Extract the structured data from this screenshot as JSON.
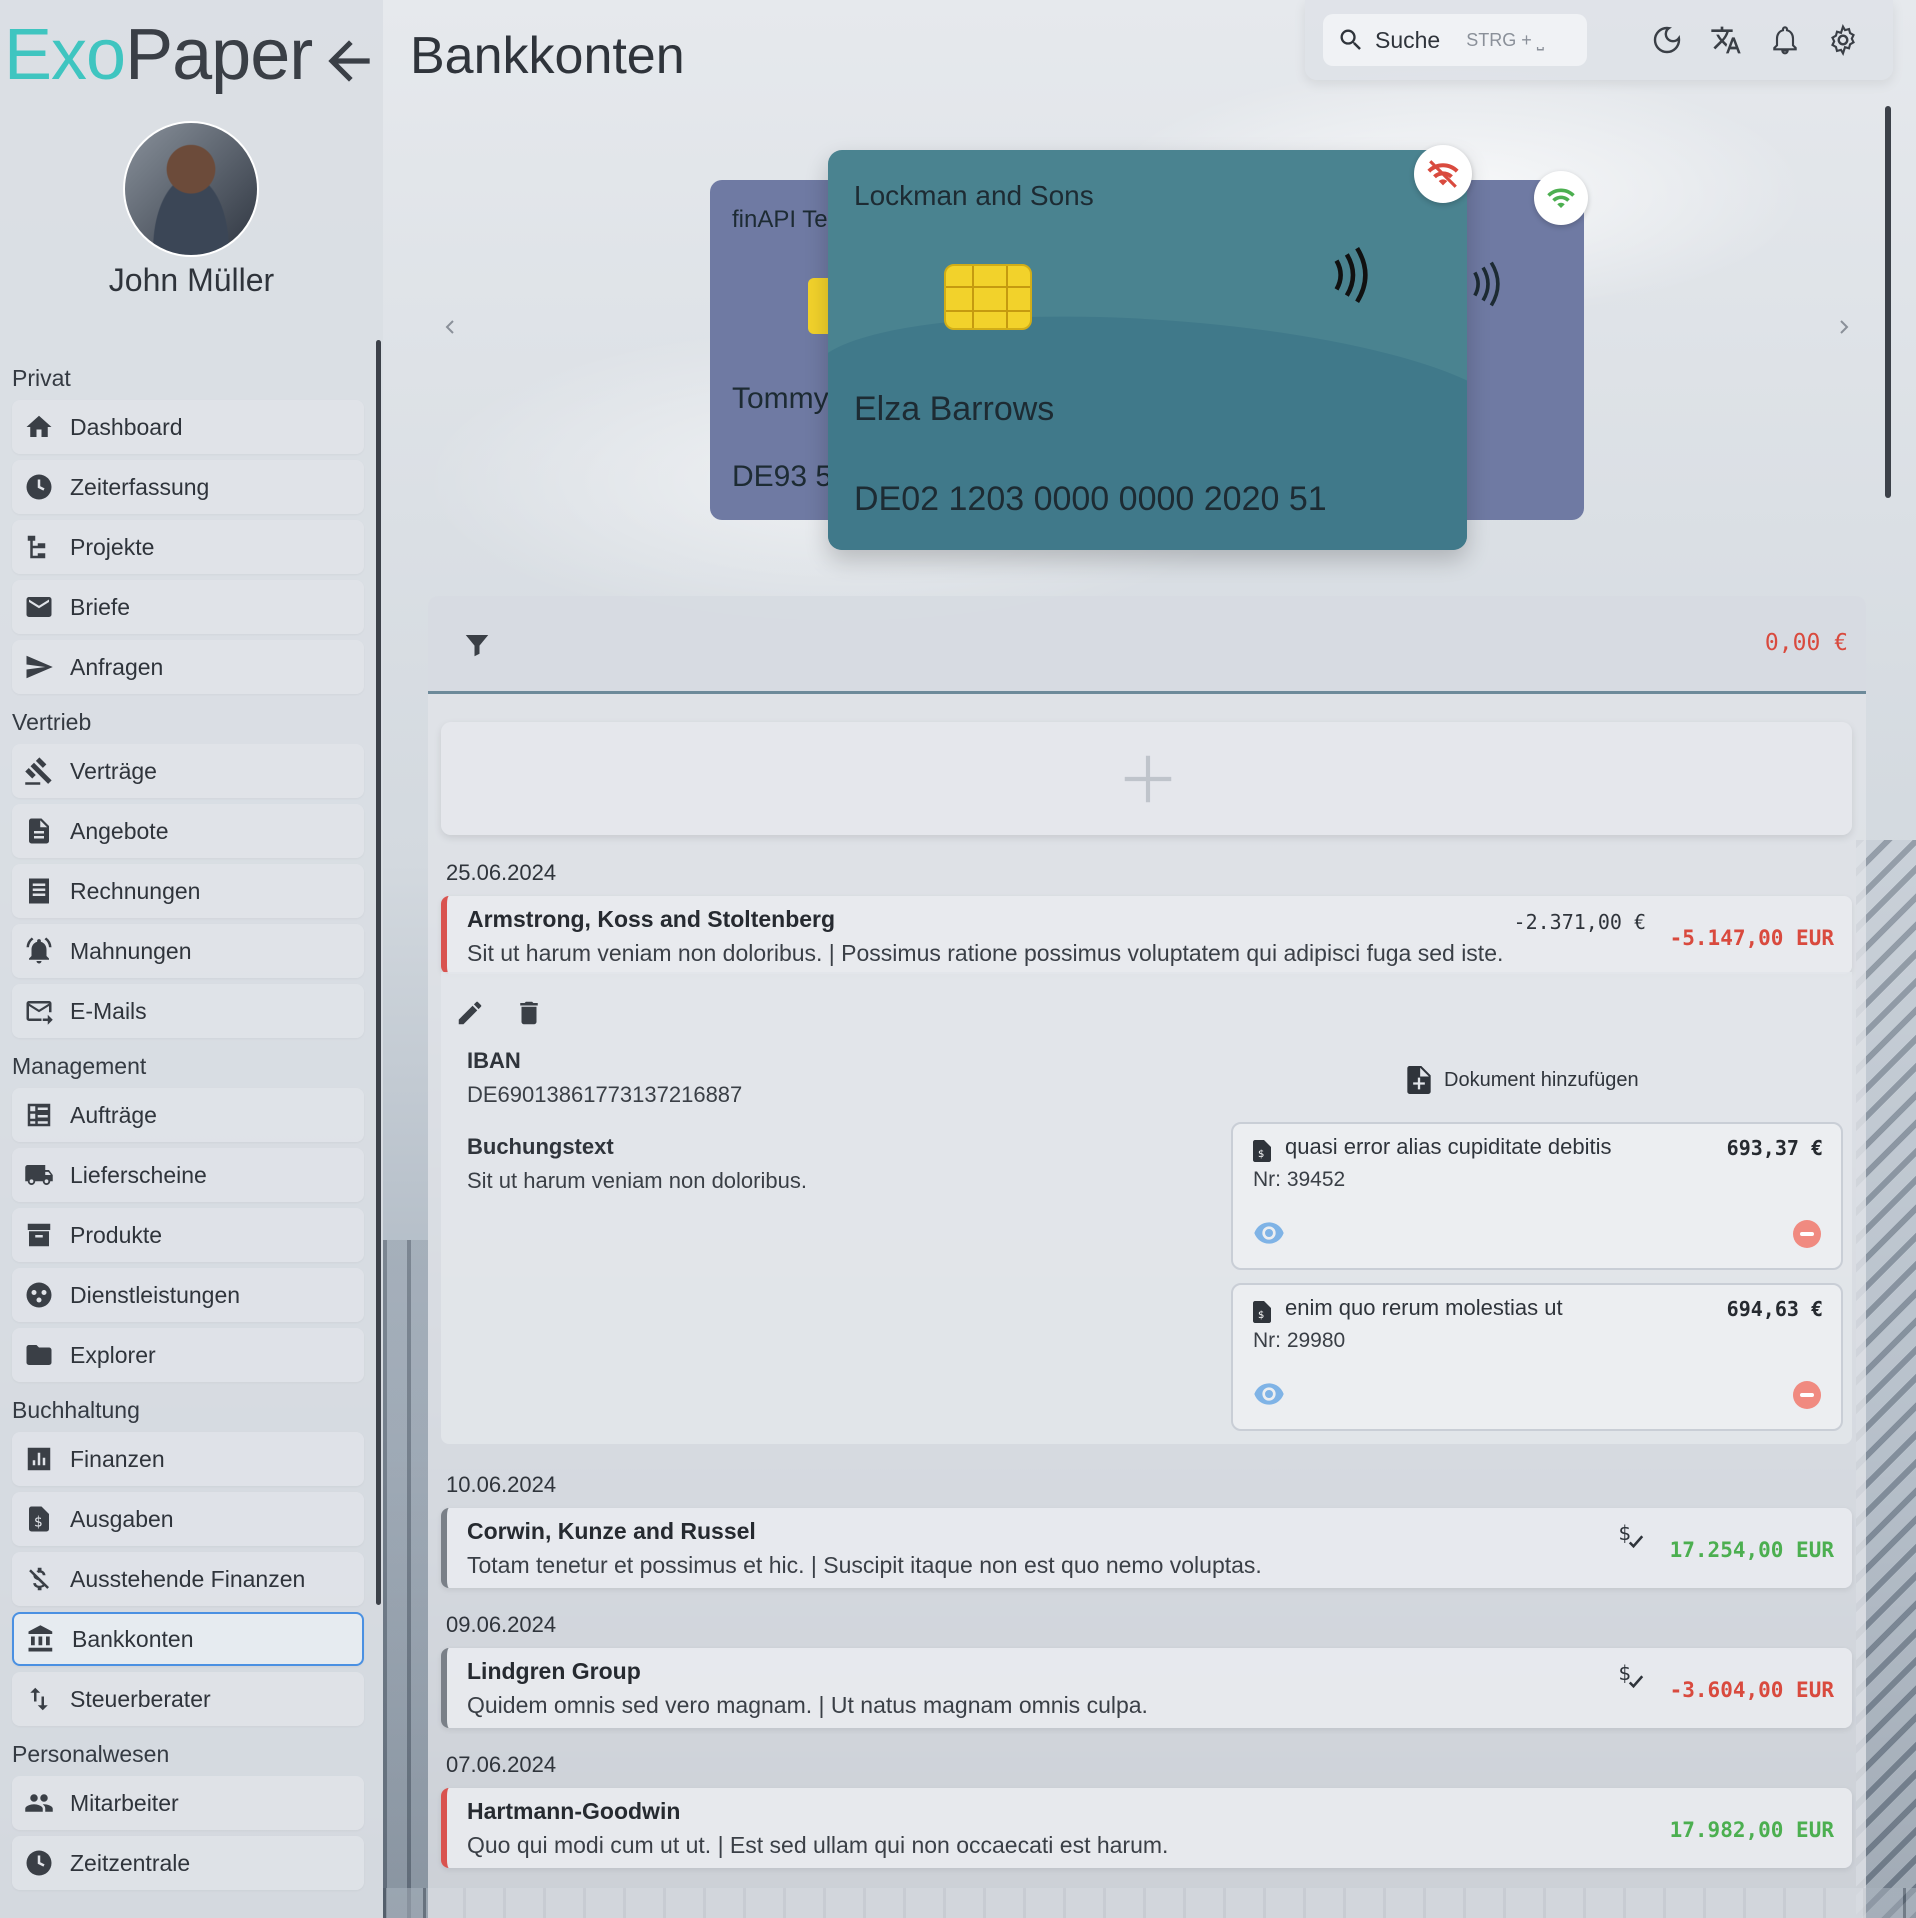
{
  "app": {
    "logo_part1": "Exo",
    "logo_part2": "Paper"
  },
  "user": {
    "name": "John Müller"
  },
  "header": {
    "title": "Bankkonten"
  },
  "topbar": {
    "search_label": "Suche",
    "search_shortcut": "STRG + ⎵"
  },
  "sidebar": {
    "sections": [
      {
        "title": "Privat",
        "items": [
          {
            "label": "Dashboard",
            "icon": "home-icon"
          },
          {
            "label": "Zeiterfassung",
            "icon": "clock-icon"
          },
          {
            "label": "Projekte",
            "icon": "project-tree-icon"
          },
          {
            "label": "Briefe",
            "icon": "mail-icon"
          },
          {
            "label": "Anfragen",
            "icon": "send-icon"
          }
        ]
      },
      {
        "title": "Vertrieb",
        "items": [
          {
            "label": "Verträge",
            "icon": "gavel-icon"
          },
          {
            "label": "Angebote",
            "icon": "document-icon"
          },
          {
            "label": "Rechnungen",
            "icon": "receipt-icon"
          },
          {
            "label": "Mahnungen",
            "icon": "alarm-bell-icon"
          },
          {
            "label": "E-Mails",
            "icon": "email-outline-icon"
          }
        ]
      },
      {
        "title": "Management",
        "items": [
          {
            "label": "Aufträge",
            "icon": "order-list-icon"
          },
          {
            "label": "Lieferscheine",
            "icon": "truck-icon"
          },
          {
            "label": "Produkte",
            "icon": "archive-icon"
          },
          {
            "label": "Dienstleistungen",
            "icon": "service-icon"
          },
          {
            "label": "Explorer",
            "icon": "folder-icon"
          }
        ]
      },
      {
        "title": "Buchhaltung",
        "items": [
          {
            "label": "Finanzen",
            "icon": "bar-chart-icon"
          },
          {
            "label": "Ausgaben",
            "icon": "expense-icon"
          },
          {
            "label": "Ausstehende Finanzen",
            "icon": "money-off-icon"
          },
          {
            "label": "Bankkonten",
            "icon": "bank-icon",
            "active": true
          },
          {
            "label": "Steuerberater",
            "icon": "swap-vertical-icon"
          }
        ]
      },
      {
        "title": "Personalwesen",
        "items": [
          {
            "label": "Mitarbeiter",
            "icon": "people-icon"
          },
          {
            "label": "Zeitzentrale",
            "icon": "clock-icon"
          }
        ]
      }
    ]
  },
  "cards": {
    "left_bank": "finAPI Te",
    "left_holder": "Tommy",
    "left_iban": "DE93 5",
    "main_bank": "Lockman and Sons",
    "main_holder": "Elza Barrows",
    "main_iban": "DE02 1203 0000 0000 2020 51"
  },
  "filter": {
    "total": "0,00 €"
  },
  "transactions": [
    {
      "date": "25.06.2024",
      "name": "Armstrong, Koss and Stoltenberg",
      "desc": "Sit ut harum veniam non doloribus. | Possimus ratione possimus voluptatem qui adipisci fuga sed iste.",
      "sub_amount": "-2.371,00 €",
      "amount": "-5.147,00 EUR",
      "detail": {
        "iban_label": "IBAN",
        "iban": "DE69013861773137216887",
        "text_label": "Buchungstext",
        "text": "Sit ut harum veniam non doloribus.",
        "add_doc": "Dokument hinzufügen",
        "docs": [
          {
            "title": "quasi error alias cupiditate debitis",
            "nr": "Nr: 39452",
            "amount": "693,37 €"
          },
          {
            "title": "enim quo rerum molestias ut",
            "nr": "Nr: 29980",
            "amount": "694,63 €"
          }
        ]
      }
    },
    {
      "date": "10.06.2024",
      "name": "Corwin, Kunze and Russel",
      "desc": "Totam tenetur et possimus et hic. | Suscipit itaque non est quo nemo voluptas.",
      "amount": "17.254,00 EUR"
    },
    {
      "date": "09.06.2024",
      "name": "Lindgren Group",
      "desc": "Quidem omnis sed vero magnam. | Ut natus magnam omnis culpa.",
      "amount": "-3.604,00 EUR"
    },
    {
      "date": "07.06.2024",
      "name": "Hartmann-Goodwin",
      "desc": "Quo qui modi cum ut ut. | Est sed ullam qui non occaecati est harum.",
      "amount": "17.982,00 EUR"
    }
  ],
  "colors": {
    "accent": "#3fc5c0",
    "negative": "#d94a3e",
    "positive": "#4caf50",
    "card_main": "#4a8390",
    "card_back": "#6f7aa3"
  }
}
